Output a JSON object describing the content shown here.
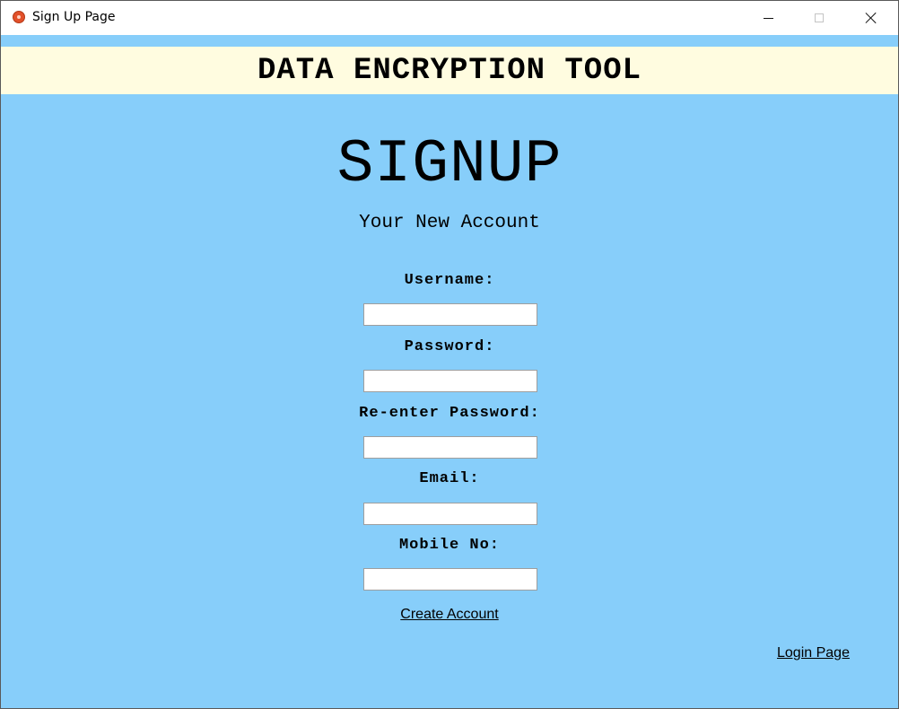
{
  "window": {
    "title": "Sign Up Page"
  },
  "banner": {
    "title": "DATA ENCRYPTION TOOL"
  },
  "form": {
    "heading": "SIGNUP",
    "subheading": "Your New Account",
    "fields": [
      {
        "label": "Username:",
        "value": ""
      },
      {
        "label": "Password:",
        "value": ""
      },
      {
        "label": "Re-enter Password:",
        "value": ""
      },
      {
        "label": "Email:",
        "value": ""
      },
      {
        "label": "Mobile No:",
        "value": ""
      }
    ],
    "create_account_label": "Create Account"
  },
  "footer": {
    "login_page_label": "Login Page"
  },
  "colors": {
    "background": "#87cefa",
    "banner_background": "#fffce0",
    "titlebar_background": "#ffffff"
  },
  "icons": {
    "app": "app-icon",
    "minimize": "minimize-icon",
    "maximize": "maximize-icon",
    "close": "close-icon"
  }
}
